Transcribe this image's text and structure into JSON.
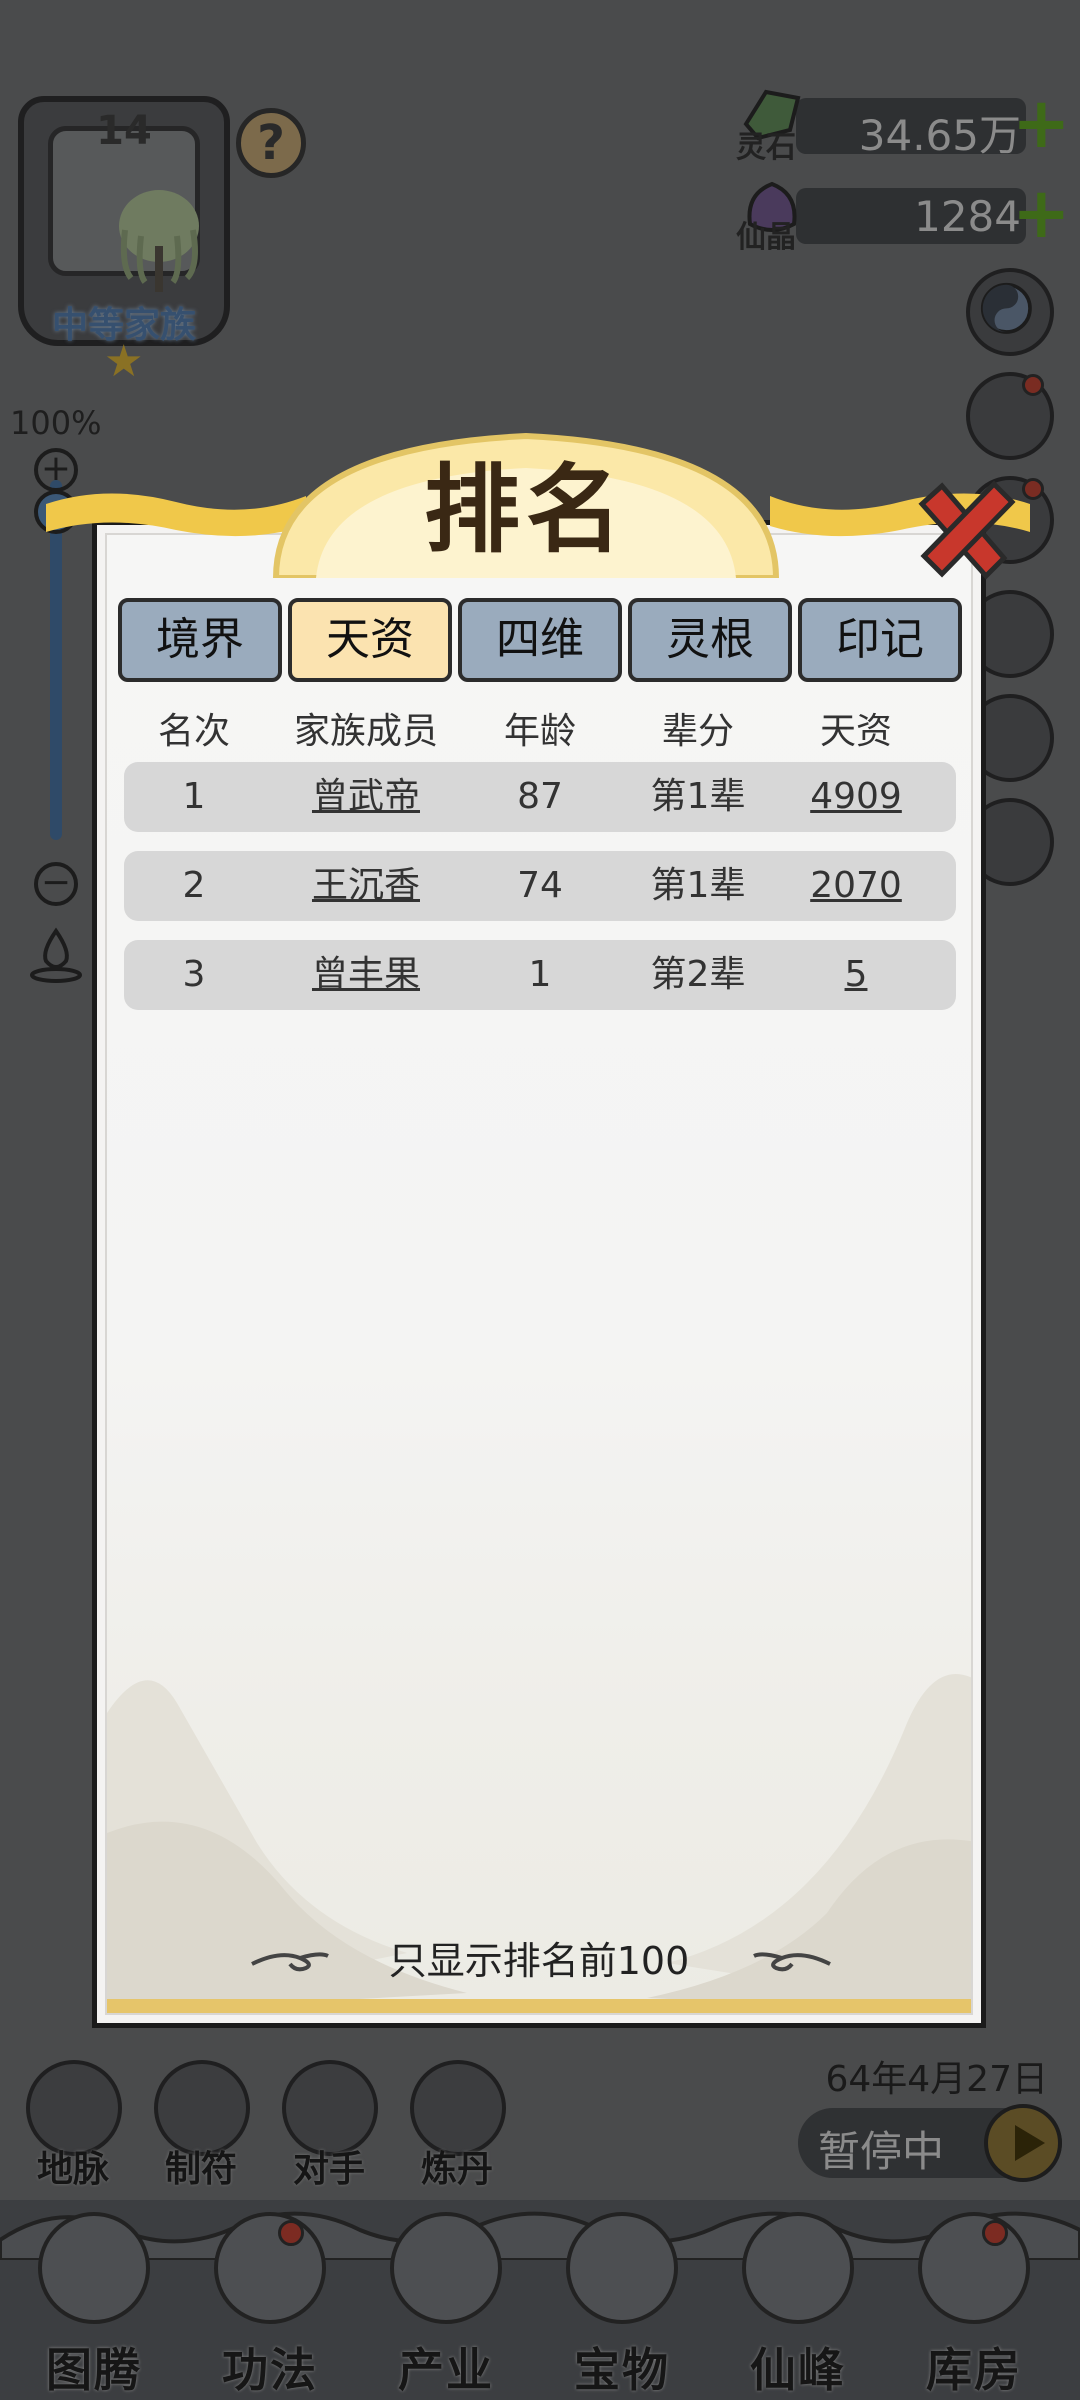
{
  "hud": {
    "clan_level": "14",
    "clan_rank": "中等家族",
    "help_symbol": "?",
    "zoom_percent": "100%",
    "zoom_level": 1.0
  },
  "resources": [
    {
      "label": "灵石",
      "value": "34.65万",
      "plus": "+"
    },
    {
      "label": "仙晶",
      "value": "1284",
      "plus": "+"
    }
  ],
  "quick_actions": [
    {
      "label": "地脉"
    },
    {
      "label": "制符"
    },
    {
      "label": "对手"
    },
    {
      "label": "炼丹"
    }
  ],
  "game_date": "64年4月27日",
  "pause_label": "暂停中",
  "bottom_nav": [
    {
      "label": "图腾"
    },
    {
      "label": "功法"
    },
    {
      "label": "产业"
    },
    {
      "label": "宝物"
    },
    {
      "label": "仙峰"
    },
    {
      "label": "库房"
    }
  ],
  "modal": {
    "title": "排名",
    "tabs": [
      {
        "label": "境界"
      },
      {
        "label": "天资"
      },
      {
        "label": "四维"
      },
      {
        "label": "灵根"
      },
      {
        "label": "印记"
      }
    ],
    "active_tab": "天资",
    "columns": [
      "名次",
      "家族成员",
      "年龄",
      "辈分",
      "天资"
    ],
    "rows": [
      {
        "rank": "1",
        "name": "曾武帝",
        "age": "87",
        "generation": "第1辈",
        "talent": "4909"
      },
      {
        "rank": "2",
        "name": "王沉香",
        "age": "74",
        "generation": "第1辈",
        "talent": "2070"
      },
      {
        "rank": "3",
        "name": "曾丰果",
        "age": "1",
        "generation": "第2辈",
        "talent": "5"
      }
    ],
    "footnote": "只显示排名前100"
  },
  "colors": {
    "overlay": "#4a4b4c",
    "tab_inactive": "#9aabbd",
    "tab_active": "#fbe3b0",
    "title_gold": "#f0c84a",
    "close_red": "#c8372c",
    "row_bg": "#d7d7d7"
  },
  "icons": [
    "help-icon",
    "lingshi-gem-icon",
    "xianjing-crystal-icon",
    "yinyang-gear-icon",
    "close-icon",
    "play-icon"
  ]
}
